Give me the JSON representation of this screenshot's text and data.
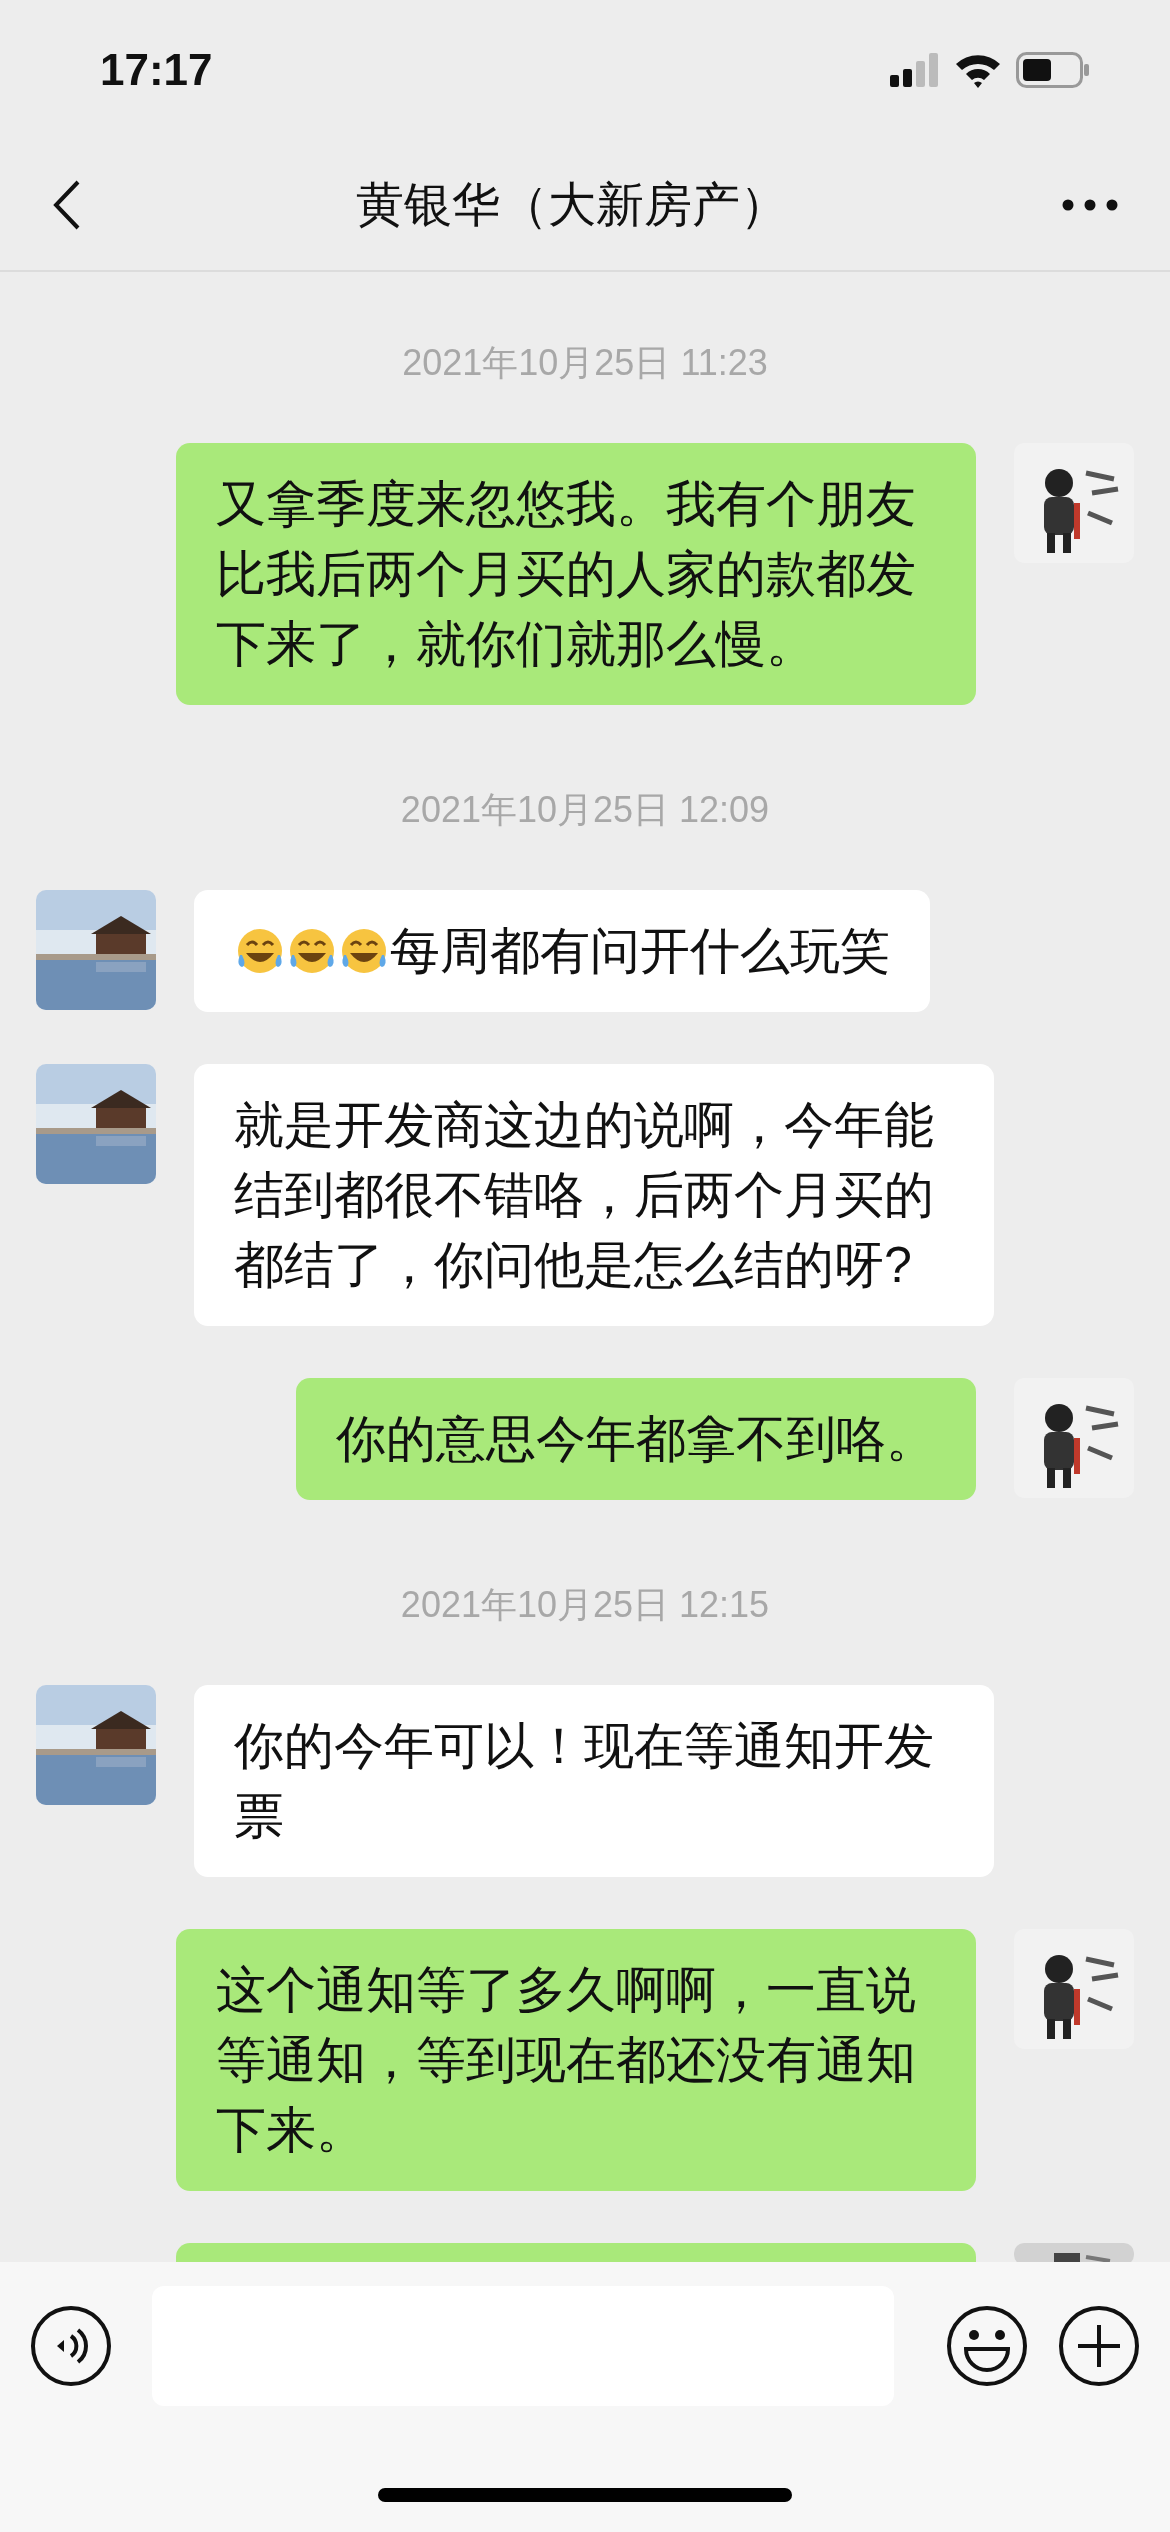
{
  "status_bar": {
    "time": "17:17"
  },
  "header": {
    "title": "黄银华（大新房产）"
  },
  "messages": [
    {
      "kind": "time",
      "text": "2021年10月25日 11:23"
    },
    {
      "kind": "bubble",
      "outgoing": true,
      "text": "又拿季度来忽悠我。我有个朋友比我后两个月买的人家的款都发下来了，就你们就那么慢。"
    },
    {
      "kind": "time",
      "text": "2021年10月25日 12:09"
    },
    {
      "kind": "bubble",
      "outgoing": false,
      "emojis": [
        {
          "kind": "tears_of_joy"
        },
        {
          "kind": "tears_of_joy"
        },
        {
          "kind": "tears_of_joy"
        }
      ],
      "text": "每周都有问开什么玩笑"
    },
    {
      "kind": "bubble",
      "outgoing": false,
      "text": "就是开发商这边的说啊，今年能结到都很不错咯，后两个月买的都结了，你问他是怎么结的呀?"
    },
    {
      "kind": "bubble",
      "outgoing": true,
      "text": "你的意思今年都拿不到咯。"
    },
    {
      "kind": "time",
      "text": "2021年10月25日 12:15"
    },
    {
      "kind": "bubble",
      "outgoing": false,
      "text": "你的今年可以！现在等通知开发票"
    },
    {
      "kind": "bubble",
      "outgoing": true,
      "text": "这个通知等了多久啊啊，一直说等通知，等到现在都还没有通知下来。"
    },
    {
      "kind": "bubble",
      "outgoing": true
    }
  ]
}
